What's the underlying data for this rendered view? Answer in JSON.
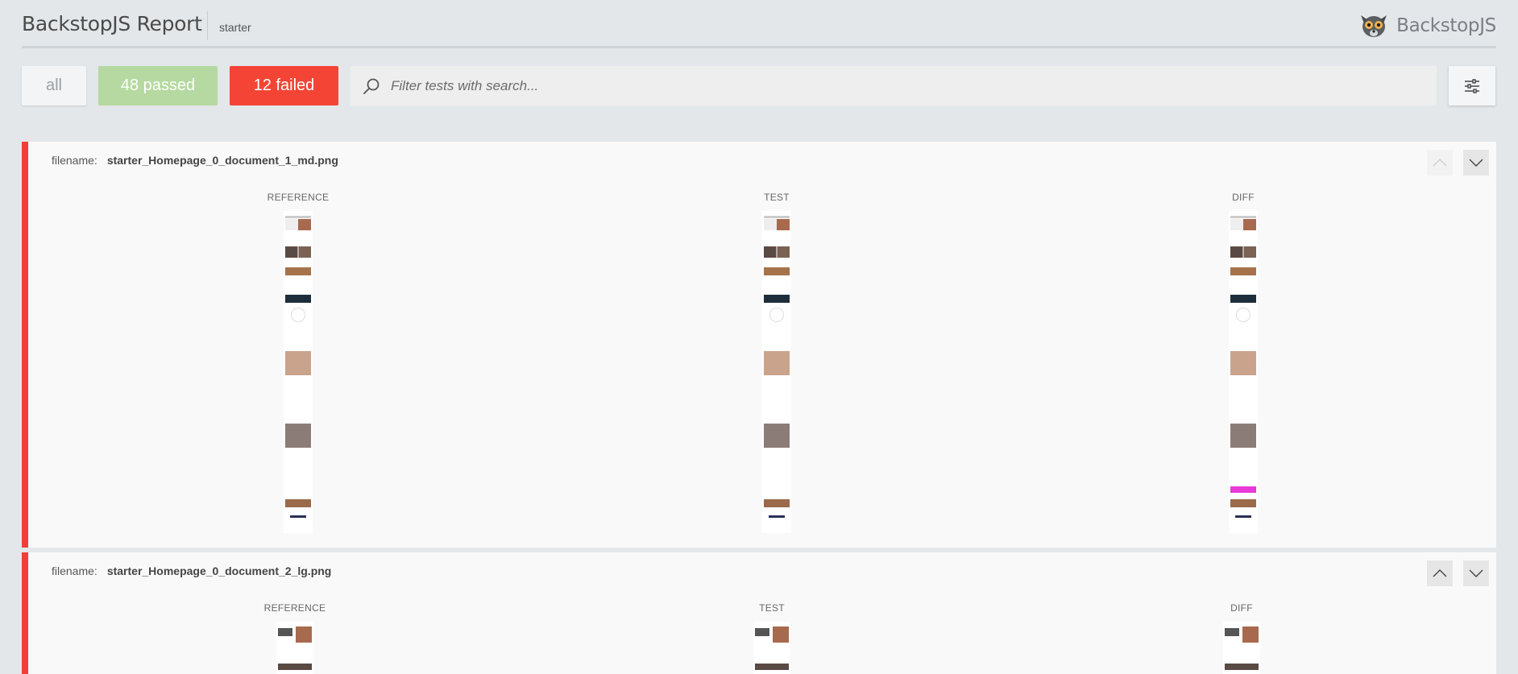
{
  "header": {
    "title": "BackstopJS Report",
    "project": "starter",
    "brand": "BackstopJS"
  },
  "toolbar": {
    "all_label": "all",
    "passed_label": "48 passed",
    "failed_label": "12 failed",
    "search_placeholder": "Filter tests with search...",
    "colors": {
      "passed": "#b5d9a0",
      "failed": "#f44436"
    }
  },
  "tests": [
    {
      "filename_label": "filename:",
      "filename": "starter_Homepage_0_document_1_md.png",
      "columns": [
        "REFERENCE",
        "TEST",
        "DIFF"
      ],
      "status": "failed"
    },
    {
      "filename_label": "filename:",
      "filename": "starter_Homepage_0_document_2_lg.png",
      "columns": [
        "REFERENCE",
        "TEST",
        "DIFF"
      ],
      "status": "failed"
    }
  ]
}
